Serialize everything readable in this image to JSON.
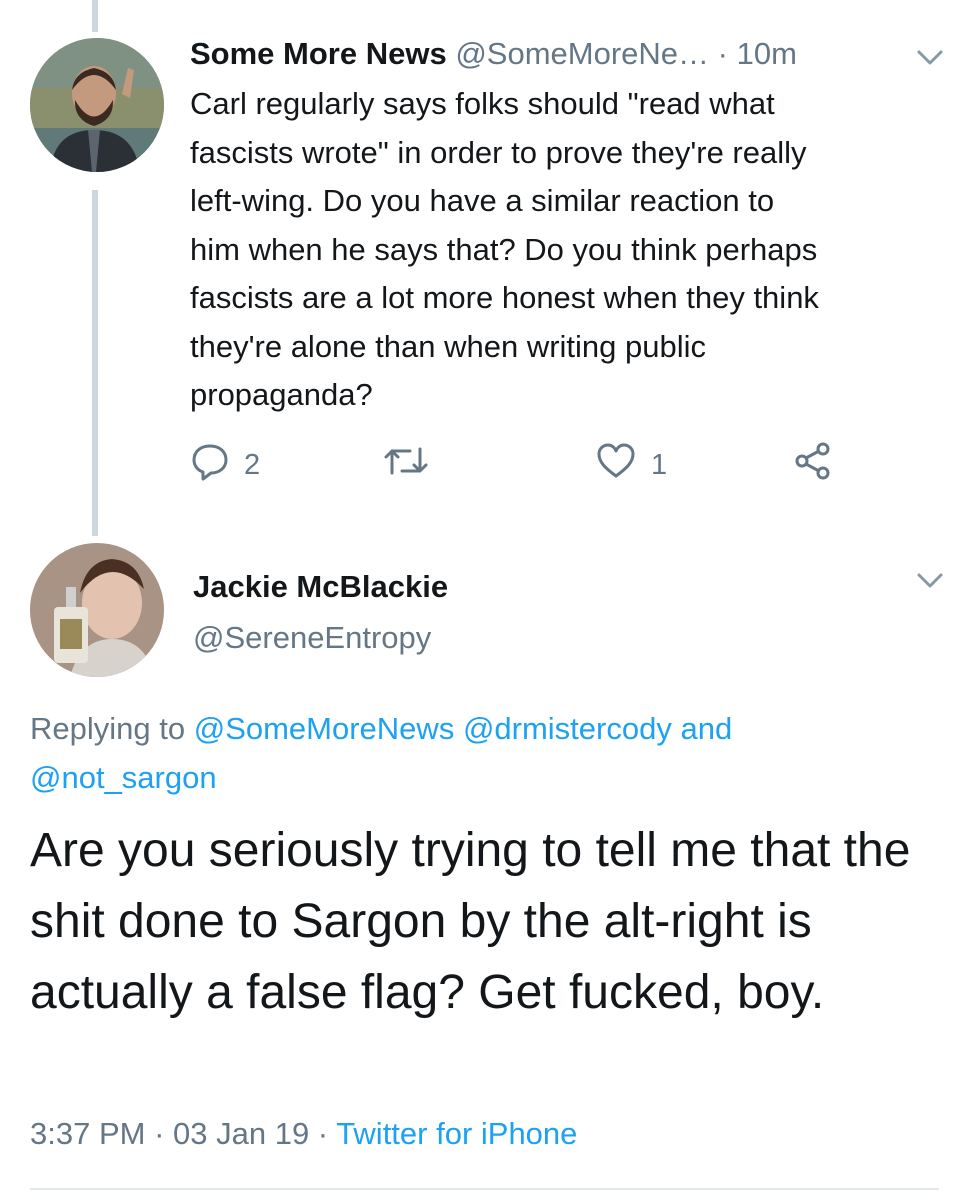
{
  "parent_tweet": {
    "display_name": "Some More News",
    "handle": "@SomeMoreNe…",
    "separator": " · ",
    "time": "10m",
    "text": "Carl regularly says folks should \"read what\nfascists wrote\" in order to prove they're really\nleft-wing. Do you have a  similar reaction to\nhim when he says that? Do you think perhaps\nfascists are a lot more honest when they think\nthey're alone than when writing public\npropaganda?",
    "reply_count": "2",
    "like_count": "1",
    "icons": [
      "reply-icon",
      "retweet-icon",
      "like-icon",
      "share-icon",
      "chevron-down-icon"
    ]
  },
  "reply_tweet": {
    "display_name": "Jackie McBlackie",
    "handle": "@SereneEntropy",
    "replying_prefix": "Replying to ",
    "replying_to": [
      "@SomeMoreNews",
      "@drmistercody",
      "@not_sargon"
    ],
    "replying_and": " and",
    "text": "Are you seriously trying to tell me that the shit done to Sargon by the alt-right is actually a false flag? Get fucked, boy.",
    "time": "3:37 PM",
    "date": "03 Jan 19",
    "dot": " · ",
    "source": "Twitter for iPhone"
  },
  "colors": {
    "text": "#14171a",
    "secondary": "#657786",
    "link": "#1da1f2",
    "thread_line": "#ccd6dd"
  }
}
